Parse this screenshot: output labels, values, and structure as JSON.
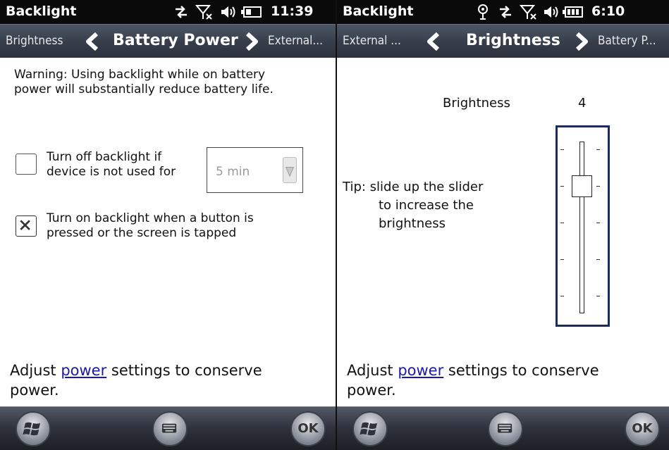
{
  "left": {
    "status": {
      "title": "Backlight",
      "time": "11:39"
    },
    "tabs": {
      "prev": "Brightness",
      "current": "Battery Power",
      "next": "External..."
    },
    "warning": [
      "Warning: Using backlight while on battery",
      "power will substantially reduce battery life."
    ],
    "option1": {
      "lines": [
        "Turn off backlight if",
        "device is not used for"
      ],
      "checked": false
    },
    "timeout": {
      "value": "5 min"
    },
    "option2": {
      "lines": [
        "Turn on backlight when a button is",
        "pressed or the screen is tapped"
      ],
      "checked": true
    },
    "footer": {
      "before": "Adjust ",
      "link": "power",
      "after": " settings to conserve",
      "line2": "power."
    },
    "bottom": {
      "ok": "OK"
    }
  },
  "right": {
    "status": {
      "title": "Backlight",
      "time": "6:10"
    },
    "tabs": {
      "prev": "External ...",
      "current": "Brightness",
      "next": "Battery P..."
    },
    "brightness_label": "Brightness",
    "brightness_value": "4",
    "tip": [
      "Tip: slide up the slider",
      "to increase the",
      "brightness"
    ],
    "slider": {
      "level": 4,
      "levels": 5
    },
    "footer": {
      "before": "Adjust ",
      "link": "power",
      "after": " settings to conserve",
      "line2": "power."
    },
    "bottom": {
      "ok": "OK"
    }
  },
  "colors": {
    "link": "#1a1aa8",
    "slider_frame": "#1d2b5a",
    "tabbar": "#363d49"
  }
}
